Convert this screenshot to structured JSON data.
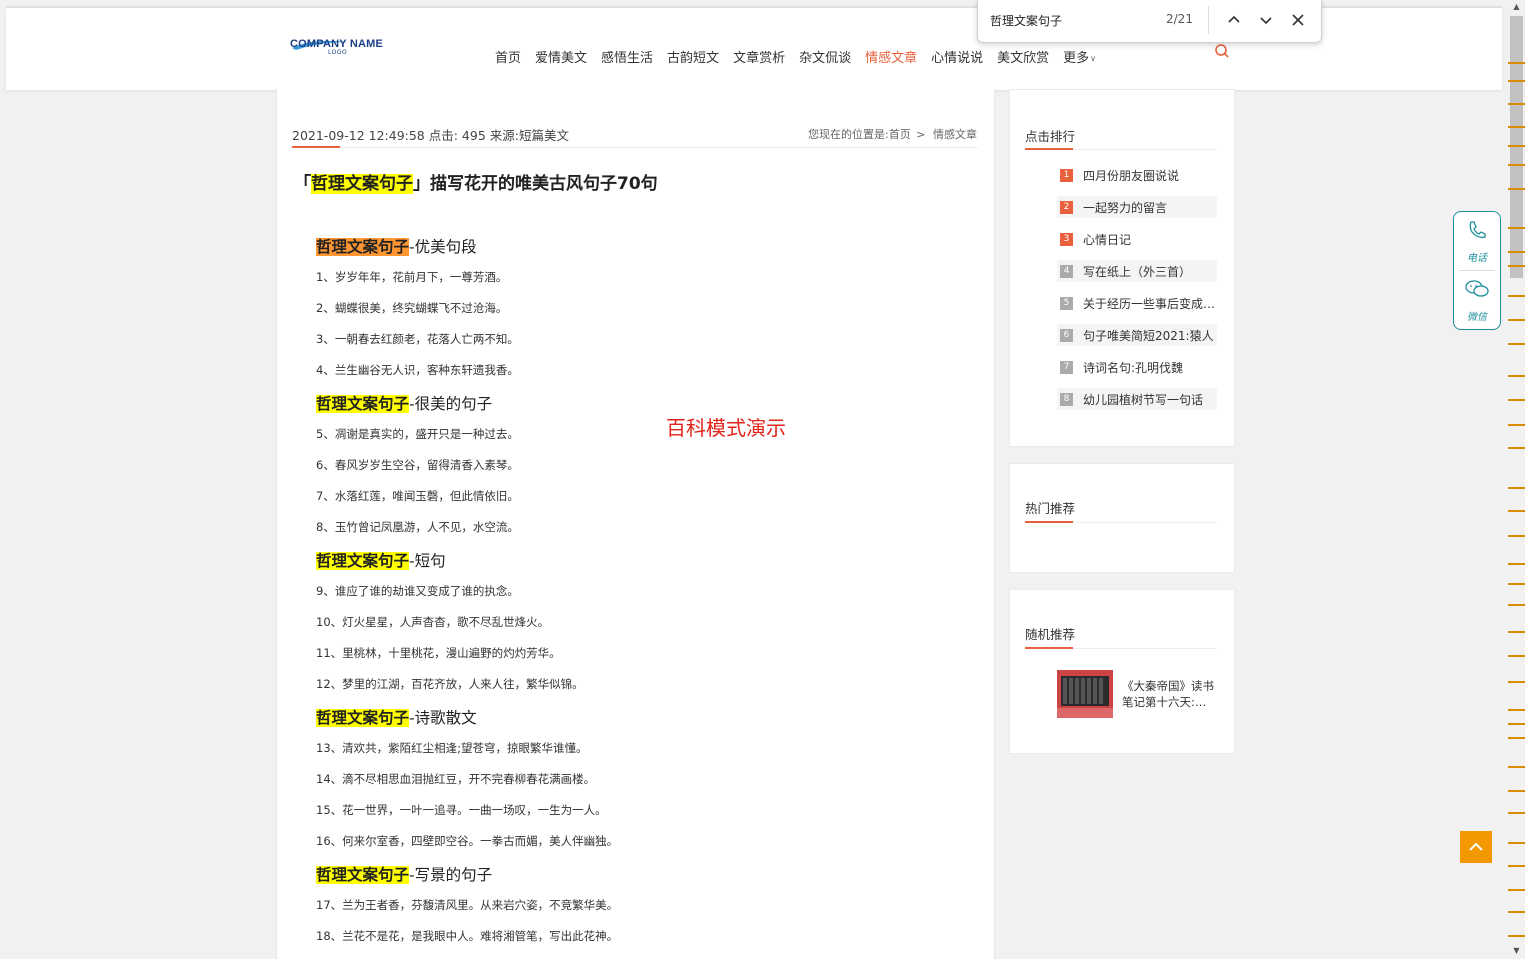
{
  "header": {
    "logo": {
      "main": "COMPANY NAME",
      "sub": "LOGO"
    },
    "nav": [
      {
        "label": "首页"
      },
      {
        "label": "爱情美文"
      },
      {
        "label": "感悟生活"
      },
      {
        "label": "古韵短文"
      },
      {
        "label": "文章赏析"
      },
      {
        "label": "杂文侃谈"
      },
      {
        "label": "情感文章",
        "active": true
      },
      {
        "label": "心情说说"
      },
      {
        "label": "美文欣赏"
      }
    ],
    "more_label": "更多"
  },
  "findbar": {
    "query": "哲理文案句子",
    "count": "2/21"
  },
  "article": {
    "meta": "2021-09-12 12:49:58 点击: 495 来源:短篇美文",
    "breadcrumb": {
      "prefix": "您现在的位置是:",
      "home": "首页",
      "sep": ">",
      "current": "情感文章"
    },
    "title": {
      "open": "「",
      "highlight": "哲理文案句子",
      "rest": "」描写花开的唯美古风句子70句"
    },
    "watermark": "百科模式演示",
    "sections": [
      {
        "highlight": "哲理文案句子",
        "rest": "-优美句段",
        "current": true,
        "lines": [
          "1、岁岁年年，花前月下，一尊芳酒。",
          "2、蝴蝶很美，终究蝴蝶飞不过沧海。",
          "3、一朝春去红颜老，花落人亡两不知。",
          "4、兰生幽谷无人识，客种东轩遗我香。"
        ]
      },
      {
        "highlight": "哲理文案句子",
        "rest": "-很美的句子",
        "current": false,
        "lines": [
          "5、凋谢是真实的，盛开只是一种过去。",
          "6、春风岁岁生空谷，留得清香入素琴。",
          "7、水落红莲，唯闻玉磬，但此情依旧。",
          "8、玉竹曾记凤凰游，人不见，水空流。"
        ]
      },
      {
        "highlight": "哲理文案句子",
        "rest": "-短句",
        "current": false,
        "lines": [
          "9、谁应了谁的劫谁又变成了谁的执念。",
          "10、灯火星星，人声杳杳，歌不尽乱世烽火。",
          "11、里桃林，十里桃花，漫山遍野的灼灼芳华。",
          "12、梦里的江湖，百花齐放，人来人往，繁华似锦。"
        ]
      },
      {
        "highlight": "哲理文案句子",
        "rest": "-诗歌散文",
        "current": false,
        "lines": [
          "13、清欢共，紫陌红尘相逢;望苍穹，掠眼繁华谁懂。",
          "14、滴不尽相思血泪抛红豆，开不完春柳春花满画楼。",
          "15、花一世界，一叶一追寻。一曲一场叹，一生为一人。",
          "16、何来尔室香，四壁即空谷。一拳古而媚，美人伴幽独。"
        ]
      },
      {
        "highlight": "哲理文案句子",
        "rest": "-写景的句子",
        "current": false,
        "lines": [
          "17、兰为王者香，芬馥清风里。从来岩穴姿，不竞繁华美。",
          "18、兰花不是花，是我眼中人。难将湘管笔，写出此花神。"
        ]
      }
    ]
  },
  "sidebar": {
    "ranking": {
      "title": "点击排行",
      "items": [
        {
          "num": "1",
          "label": "四月份朋友圈说说",
          "color": "#e8603c"
        },
        {
          "num": "2",
          "label": "一起努力的留言",
          "color": "#e8603c"
        },
        {
          "num": "3",
          "label": "心情日记",
          "color": "#e8603c"
        },
        {
          "num": "4",
          "label": "写在纸上（外三首）",
          "color": "#aaaaaa"
        },
        {
          "num": "5",
          "label": "关于经历一些事后变成熟的句子",
          "color": "#aaaaaa"
        },
        {
          "num": "6",
          "label": "句子唯美简短2021:猿人",
          "color": "#aaaaaa"
        },
        {
          "num": "7",
          "label": "诗词名句:孔明伐魏",
          "color": "#aaaaaa"
        },
        {
          "num": "8",
          "label": "幼儿园植树节写一句话",
          "color": "#aaaaaa"
        }
      ]
    },
    "hot": {
      "title": "热门推荐"
    },
    "random": {
      "title": "随机推荐",
      "item": "《大秦帝国》读书笔记第十六天:…"
    }
  },
  "contact": {
    "phone": "电话",
    "wechat": "微信"
  }
}
